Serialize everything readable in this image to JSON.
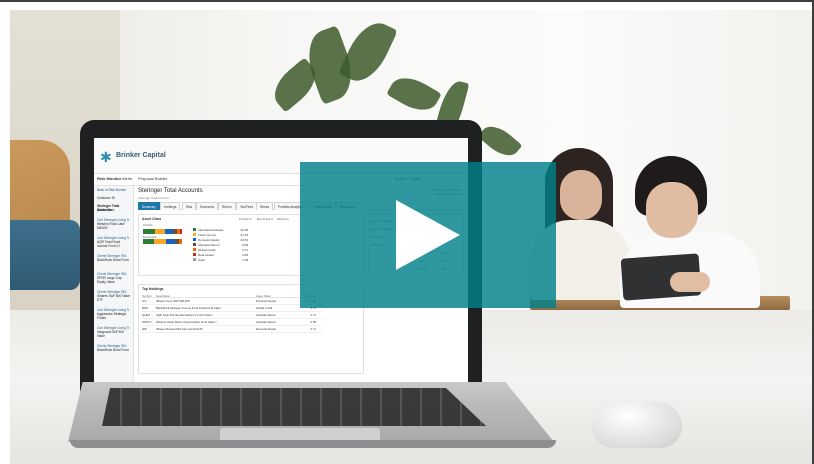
{
  "video": {
    "play_button_label": "Play video"
  },
  "app": {
    "brand": "Brinker Capital",
    "nav": [
      "Risk Monitor",
      "Alerts",
      "Proposal Builder"
    ],
    "nav_right": [
      "Search",
      "Profile"
    ],
    "sidebar": {
      "back_link": "Back to Risk Monitor",
      "section_label": "Customer ID",
      "items": [
        {
          "title": "Steringer Total Accounts",
          "detail": "Stable Cash"
        },
        {
          "title": "Carl Steringer Living Tr.",
          "detail": "Weisbro Rock Lake MINOR"
        },
        {
          "title": "Carl Steringer Living Tr.",
          "detail": "AQR Total Fixed Income Fund Cl"
        },
        {
          "title": "Cherie Steringer IRA",
          "detail": "BlackRock Bond Fund"
        },
        {
          "title": "Cherie Steringer IRA",
          "detail": "SPDR Large Cap Equity Value"
        },
        {
          "title": "Cherie Steringer IRA",
          "detail": "iShares S&P 500 Value ETF"
        },
        {
          "title": "Carl Steringer Living Tr.",
          "detail": "Aggressive Strategic Funds"
        },
        {
          "title": "Carl Steringer Living Tr.",
          "detail": "Vanguard S&P 500 Value"
        },
        {
          "title": "Cherie Steringer IRA",
          "detail": "BlackRock Bond Fund"
        }
      ]
    },
    "account": {
      "title": "Steringer Total Accounts",
      "subtitle": "Steringer Total Account",
      "top_links": [
        "Edit Proposal / Portfolio",
        "Print Report / Export"
      ]
    },
    "tabs": [
      "Summary",
      "Holdings",
      "Risk",
      "Scenarios",
      "Return",
      "Tax/Fees",
      "Stress",
      "Portfolio Analytics",
      "Fund Details",
      "Rebalance"
    ],
    "asset_class": {
      "title": "Asset Class",
      "bar_labels": [
        "Portfolio",
        "Benchmark"
      ],
      "columns": [
        "Portfolio %",
        "Benchmark %",
        "Difference"
      ],
      "legend": [
        {
          "name": "International Equity",
          "color": "#2e7d32",
          "value": "31.08"
        },
        {
          "name": "Fixed Income",
          "color": "#f9a825",
          "value": "27.03"
        },
        {
          "name": "Domestic Equity",
          "color": "#1565c0",
          "value": "20.53"
        },
        {
          "name": "Absolute Return",
          "color": "#6d4c41",
          "value": "8.08"
        },
        {
          "name": "Global Credit",
          "color": "#ef6c00",
          "value": "5.71"
        },
        {
          "name": "Real Assets",
          "color": "#c62828",
          "value": "4.08"
        },
        {
          "name": "Cash",
          "color": "#9e9e9e",
          "value": "1.08"
        }
      ]
    },
    "top_holdings": {
      "title": "Top Holdings",
      "columns": [
        "Symbol",
        "Description",
        "Asset Class",
        "% of Total"
      ],
      "rows": [
        {
          "symbol": "IVV",
          "description": "iShares Core S&P 500 ETF",
          "asset_class": "Domestic Equity",
          "pct": "4.08"
        },
        {
          "symbol": "BICK",
          "description": "BlackRock Strategic Income Fund Institutional Class",
          "asset_class": "Global Credit",
          "pct": "3.71"
        },
        {
          "symbol": "QLEIX",
          "description": "AQR Style Premia Alternative LV Fund Class I",
          "asset_class": "Absolute Return",
          "pct": "2.71"
        },
        {
          "symbol": "WINCX",
          "description": "Western Asset Macro Opportunities Fund Class I",
          "asset_class": "Absolute Return",
          "pct": "2.08"
        },
        {
          "symbol": "IWF",
          "description": "iShares Russell Mid-Cap Growth ETF",
          "asset_class": "Domestic Equity",
          "pct": "2.71"
        }
      ]
    },
    "right_panel": {
      "lines": [
        "Avg. 1-Yr Trailing Yield (%)",
        "Avg. 3-Yr Trailing Yield (%)",
        "P/E Ratio",
        "P/B Ratio"
      ],
      "values": [
        "0.89",
        "15.18",
        "2.08",
        "3.72",
        "15.76",
        "1.96"
      ]
    }
  }
}
